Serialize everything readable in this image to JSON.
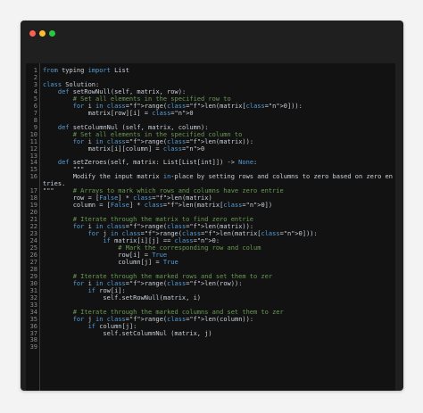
{
  "editor": {
    "lines": [
      {
        "n": "1",
        "t": "from typing import List"
      },
      {
        "n": "2",
        "t": ""
      },
      {
        "n": "3",
        "t": "class Solution:"
      },
      {
        "n": "4",
        "t": "    def setRowNull(self, matrix, row):"
      },
      {
        "n": "5",
        "t": "        # Set all elements in the specified row to"
      },
      {
        "n": "6",
        "t": "        for i in range(len(matrix[0])):"
      },
      {
        "n": "7",
        "t": "            matrix[row][i] = 0"
      },
      {
        "n": "8",
        "t": ""
      },
      {
        "n": "9",
        "t": "    def setColumnNul (self, matrix, column):"
      },
      {
        "n": "10",
        "t": "        # Set all elements in the specified column to"
      },
      {
        "n": "11",
        "t": "        for i in range(len(matrix)):"
      },
      {
        "n": "12",
        "t": "            matrix[i][column] = 0"
      },
      {
        "n": "13",
        "t": ""
      },
      {
        "n": "14",
        "t": "    def setZeroes(self, matrix: List[List[int]]) -> None:"
      },
      {
        "n": "15",
        "t": "        \"\"\""
      },
      {
        "n": "16",
        "t": "        Modify the input matrix in-place by setting rows and columns to zero based on zero en"
      },
      {
        "n": "",
        "t": "tries."
      },
      {
        "n": "17",
        "t": "\"\"\"     # Arrays to mark which rows and columns have zero entrie"
      },
      {
        "n": "18",
        "t": "        row = [False] * len(matrix)"
      },
      {
        "n": "19",
        "t": "        column = [False] * len(matrix[0])"
      },
      {
        "n": "20",
        "t": ""
      },
      {
        "n": "21",
        "t": "        # Iterate through the matrix to find zero entrie"
      },
      {
        "n": "22",
        "t": "        for i in range(len(matrix)):"
      },
      {
        "n": "23",
        "t": "            for j in range(len(matrix[0])):"
      },
      {
        "n": "24",
        "t": "                if matrix[i][j] == 0:"
      },
      {
        "n": "25",
        "t": "                    # Mark the corresponding row and colum"
      },
      {
        "n": "26",
        "t": "                    row[i] = True"
      },
      {
        "n": "27",
        "t": "                    column[j] = True"
      },
      {
        "n": "28",
        "t": ""
      },
      {
        "n": "29",
        "t": "        # Iterate through the marked rows and set them to zer"
      },
      {
        "n": "30",
        "t": "        for i in range(len(row)):"
      },
      {
        "n": "31",
        "t": "            if row[i]:"
      },
      {
        "n": "32",
        "t": "                self.setRowNull(matrix, i)"
      },
      {
        "n": "33",
        "t": ""
      },
      {
        "n": "34",
        "t": "        # Iterate through the marked columns and set them to zer"
      },
      {
        "n": "35",
        "t": "        for j in range(len(column)):"
      },
      {
        "n": "36",
        "t": "            if column[j]:"
      },
      {
        "n": "37",
        "t": "                self.setColumnNul (matrix, j)"
      },
      {
        "n": "38",
        "t": ""
      },
      {
        "n": "39",
        "t": ""
      }
    ]
  },
  "colors": {
    "background": "#f3f3f3",
    "window": "#1f1f1f",
    "editor": "#121212",
    "keyword": "#569cd6",
    "comment": "#6a9955",
    "function": "#dcdcaa",
    "number": "#b5cea8"
  }
}
